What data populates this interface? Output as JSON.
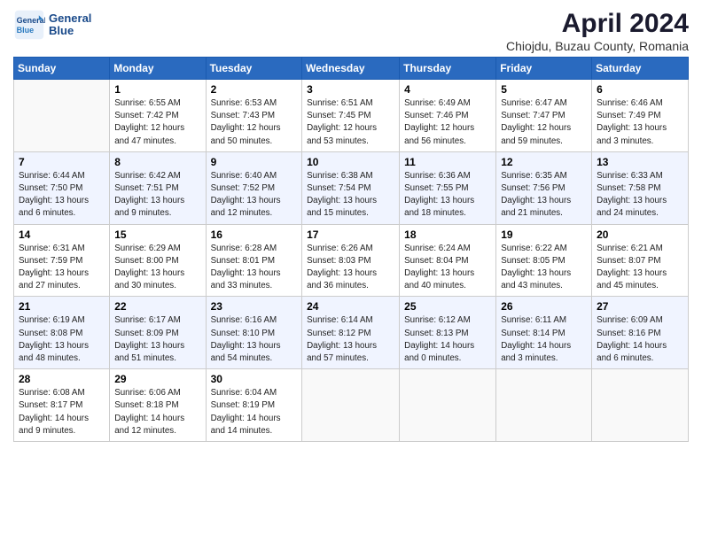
{
  "logo": {
    "line1": "General",
    "line2": "Blue"
  },
  "title": "April 2024",
  "subtitle": "Chiojdu, Buzau County, Romania",
  "weekdays": [
    "Sunday",
    "Monday",
    "Tuesday",
    "Wednesday",
    "Thursday",
    "Friday",
    "Saturday"
  ],
  "weeks": [
    [
      {
        "day": "",
        "info": ""
      },
      {
        "day": "1",
        "info": "Sunrise: 6:55 AM\nSunset: 7:42 PM\nDaylight: 12 hours\nand 47 minutes."
      },
      {
        "day": "2",
        "info": "Sunrise: 6:53 AM\nSunset: 7:43 PM\nDaylight: 12 hours\nand 50 minutes."
      },
      {
        "day": "3",
        "info": "Sunrise: 6:51 AM\nSunset: 7:45 PM\nDaylight: 12 hours\nand 53 minutes."
      },
      {
        "day": "4",
        "info": "Sunrise: 6:49 AM\nSunset: 7:46 PM\nDaylight: 12 hours\nand 56 minutes."
      },
      {
        "day": "5",
        "info": "Sunrise: 6:47 AM\nSunset: 7:47 PM\nDaylight: 12 hours\nand 59 minutes."
      },
      {
        "day": "6",
        "info": "Sunrise: 6:46 AM\nSunset: 7:49 PM\nDaylight: 13 hours\nand 3 minutes."
      }
    ],
    [
      {
        "day": "7",
        "info": "Sunrise: 6:44 AM\nSunset: 7:50 PM\nDaylight: 13 hours\nand 6 minutes."
      },
      {
        "day": "8",
        "info": "Sunrise: 6:42 AM\nSunset: 7:51 PM\nDaylight: 13 hours\nand 9 minutes."
      },
      {
        "day": "9",
        "info": "Sunrise: 6:40 AM\nSunset: 7:52 PM\nDaylight: 13 hours\nand 12 minutes."
      },
      {
        "day": "10",
        "info": "Sunrise: 6:38 AM\nSunset: 7:54 PM\nDaylight: 13 hours\nand 15 minutes."
      },
      {
        "day": "11",
        "info": "Sunrise: 6:36 AM\nSunset: 7:55 PM\nDaylight: 13 hours\nand 18 minutes."
      },
      {
        "day": "12",
        "info": "Sunrise: 6:35 AM\nSunset: 7:56 PM\nDaylight: 13 hours\nand 21 minutes."
      },
      {
        "day": "13",
        "info": "Sunrise: 6:33 AM\nSunset: 7:58 PM\nDaylight: 13 hours\nand 24 minutes."
      }
    ],
    [
      {
        "day": "14",
        "info": "Sunrise: 6:31 AM\nSunset: 7:59 PM\nDaylight: 13 hours\nand 27 minutes."
      },
      {
        "day": "15",
        "info": "Sunrise: 6:29 AM\nSunset: 8:00 PM\nDaylight: 13 hours\nand 30 minutes."
      },
      {
        "day": "16",
        "info": "Sunrise: 6:28 AM\nSunset: 8:01 PM\nDaylight: 13 hours\nand 33 minutes."
      },
      {
        "day": "17",
        "info": "Sunrise: 6:26 AM\nSunset: 8:03 PM\nDaylight: 13 hours\nand 36 minutes."
      },
      {
        "day": "18",
        "info": "Sunrise: 6:24 AM\nSunset: 8:04 PM\nDaylight: 13 hours\nand 40 minutes."
      },
      {
        "day": "19",
        "info": "Sunrise: 6:22 AM\nSunset: 8:05 PM\nDaylight: 13 hours\nand 43 minutes."
      },
      {
        "day": "20",
        "info": "Sunrise: 6:21 AM\nSunset: 8:07 PM\nDaylight: 13 hours\nand 45 minutes."
      }
    ],
    [
      {
        "day": "21",
        "info": "Sunrise: 6:19 AM\nSunset: 8:08 PM\nDaylight: 13 hours\nand 48 minutes."
      },
      {
        "day": "22",
        "info": "Sunrise: 6:17 AM\nSunset: 8:09 PM\nDaylight: 13 hours\nand 51 minutes."
      },
      {
        "day": "23",
        "info": "Sunrise: 6:16 AM\nSunset: 8:10 PM\nDaylight: 13 hours\nand 54 minutes."
      },
      {
        "day": "24",
        "info": "Sunrise: 6:14 AM\nSunset: 8:12 PM\nDaylight: 13 hours\nand 57 minutes."
      },
      {
        "day": "25",
        "info": "Sunrise: 6:12 AM\nSunset: 8:13 PM\nDaylight: 14 hours\nand 0 minutes."
      },
      {
        "day": "26",
        "info": "Sunrise: 6:11 AM\nSunset: 8:14 PM\nDaylight: 14 hours\nand 3 minutes."
      },
      {
        "day": "27",
        "info": "Sunrise: 6:09 AM\nSunset: 8:16 PM\nDaylight: 14 hours\nand 6 minutes."
      }
    ],
    [
      {
        "day": "28",
        "info": "Sunrise: 6:08 AM\nSunset: 8:17 PM\nDaylight: 14 hours\nand 9 minutes."
      },
      {
        "day": "29",
        "info": "Sunrise: 6:06 AM\nSunset: 8:18 PM\nDaylight: 14 hours\nand 12 minutes."
      },
      {
        "day": "30",
        "info": "Sunrise: 6:04 AM\nSunset: 8:19 PM\nDaylight: 14 hours\nand 14 minutes."
      },
      {
        "day": "",
        "info": ""
      },
      {
        "day": "",
        "info": ""
      },
      {
        "day": "",
        "info": ""
      },
      {
        "day": "",
        "info": ""
      }
    ]
  ]
}
